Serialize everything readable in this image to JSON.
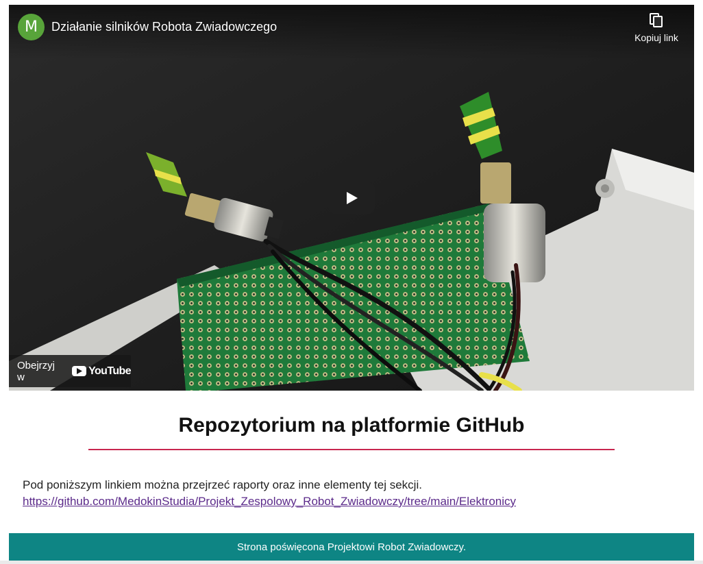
{
  "video": {
    "channel_initial": "M",
    "title": "Działanie silników Robota Zwiadowczego",
    "copy_link_label": "Kopiuj link",
    "watch_on_label": "Obejrzyj w",
    "youtube_label": "YouTube",
    "avatar_color": "#58a43a"
  },
  "section": {
    "heading": "Repozytorium na platformie GitHub",
    "accent_color": "#c8264f",
    "description": "Pod poniższym linkiem można przejrzeć raporty oraz inne elementy tej sekcji.",
    "link_text": "https://github.com/MedokinStudia/Projekt_Zespolowy_Robot_Zwiadowczy/tree/main/Elektronicy"
  },
  "footer": {
    "text": "Strona poświęcona Projektowi Robot Zwiadowczy.",
    "color": "#0e8584"
  }
}
